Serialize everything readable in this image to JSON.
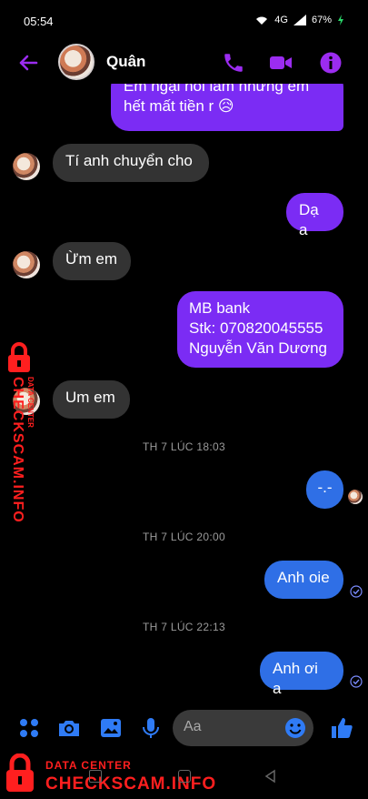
{
  "status_bar": {
    "time": "05:54",
    "network": "4G",
    "battery": "67%"
  },
  "header": {
    "contact_name": "Quân",
    "icons": [
      "back-arrow-icon",
      "avatar",
      "phone-icon",
      "video-icon",
      "info-icon"
    ]
  },
  "messages": [
    {
      "dir": "out",
      "text_line1": "Em ngại hỏi lắm nhưng em",
      "text_line2": "hết mất tiền r 😥"
    },
    {
      "dir": "in",
      "text": "Tí anh chuyển cho"
    },
    {
      "dir": "out",
      "text": "Dạ a"
    },
    {
      "dir": "in",
      "text": "Ừm em"
    },
    {
      "dir": "out",
      "line1": "MB bank",
      "line2": "Stk: 070820045555",
      "line3": "Nguyễn Văn Dương"
    },
    {
      "dir": "in",
      "text": "Um em"
    },
    {
      "type": "timestamp",
      "text": "TH 7 LÚC 18:03"
    },
    {
      "dir": "out",
      "text": "-.-"
    },
    {
      "type": "timestamp",
      "text": "TH 7 LÚC 20:00"
    },
    {
      "dir": "out",
      "text": "Anh oie"
    },
    {
      "type": "timestamp",
      "text": "TH 7 LÚC 22:13"
    },
    {
      "dir": "out",
      "text": "Anh ơi a"
    }
  ],
  "composer": {
    "placeholder": "Aa"
  },
  "watermark": {
    "label": "DATA CENTER",
    "brand": "CHECKSCAM.INFO"
  },
  "colors": {
    "accent": "#7b2cf4",
    "blue_bubble": "#2f6fe6",
    "incoming": "#333333",
    "watermark": "#ff1f1f"
  }
}
